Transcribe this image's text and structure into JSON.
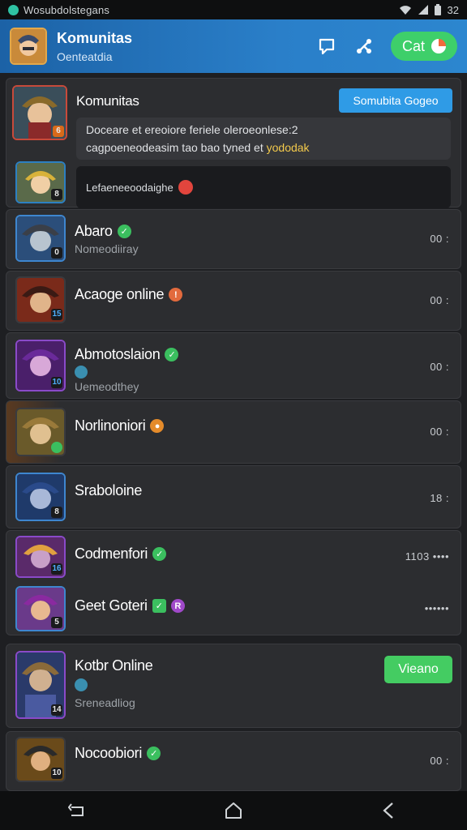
{
  "status_bar": {
    "carrier": "Wosubdolstegans",
    "clock": "32"
  },
  "header": {
    "title": "Komunitas",
    "subtitle": "Oenteatdia",
    "cat_label": "Cat"
  },
  "featured": {
    "name": "Komunitas",
    "level": "6",
    "join_label": "Somubita Gogeo",
    "message_line1": "Doceare et ereoiore feriele oleroeonlese:2",
    "message_line2": "cagpoeneodeasim tao bao tyned et",
    "message_highlight": "yododak",
    "second_level": "8",
    "dark_text": "Lefaeneeoodaighe"
  },
  "members": [
    {
      "name": "Abaro",
      "sub": "Nomeodiiray",
      "level": "0",
      "more": "00 :"
    },
    {
      "name": "Acaoge online",
      "sub": "",
      "level": "15",
      "more": "00 :"
    },
    {
      "name": "Abmotoslaion",
      "sub": "Uemeodthey",
      "level": "10",
      "more": "00 :"
    },
    {
      "name": "Norlinoniori",
      "sub": "",
      "level": "",
      "more": "00 :"
    },
    {
      "name": "Sraboloine",
      "sub": "",
      "level": "8",
      "more": "18 :"
    },
    {
      "name": "Codmenfori",
      "sub": "",
      "level": "16",
      "more": "1103 ••••"
    },
    {
      "name": "Geet Goteri",
      "sub": "",
      "level": "5",
      "more": "••••••"
    },
    {
      "name": "Kotbr Online",
      "sub": "Sreneadliog",
      "level": "14",
      "view_label": "Vieano"
    },
    {
      "name": "Nocoobiori",
      "sub": "",
      "level": "10",
      "more": "00 :"
    }
  ],
  "colors": {
    "header_blue": "#2a7fc9",
    "accent_green": "#3ecf6a",
    "join_blue": "#2f9be6"
  }
}
